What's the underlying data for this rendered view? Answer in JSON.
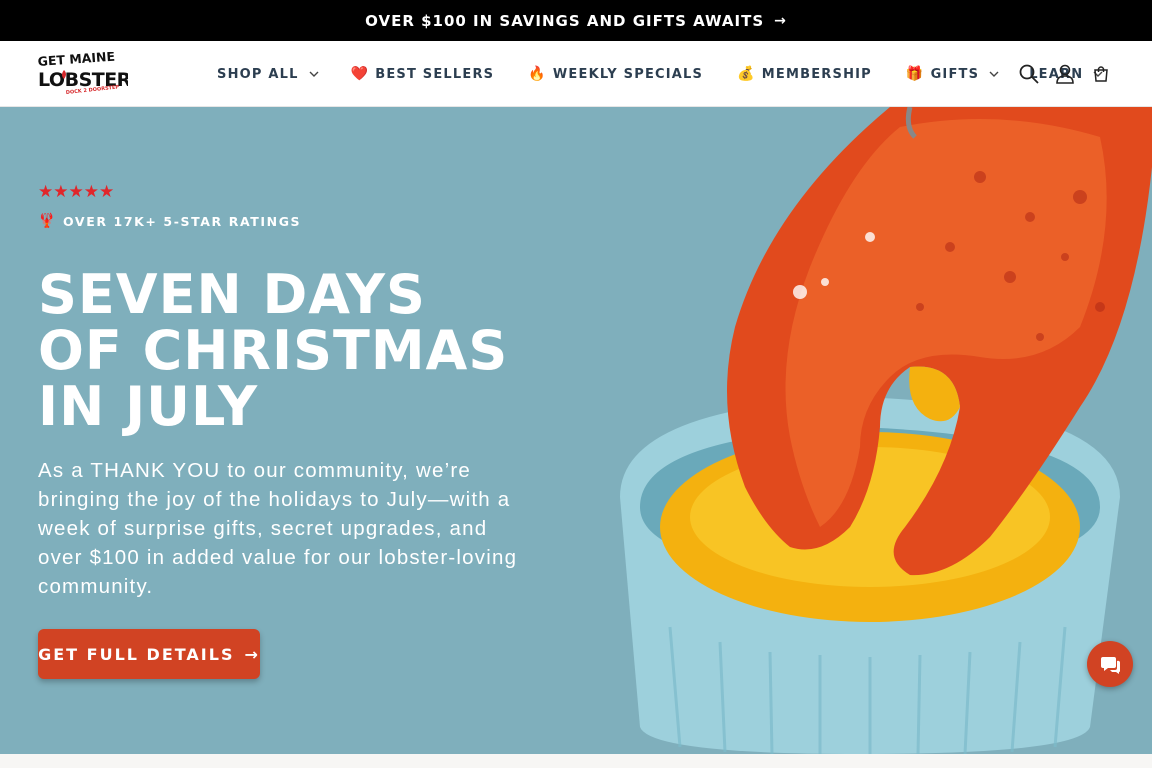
{
  "announcement": {
    "text": "OVER $100 IN SAVINGS AND GIFTS AWAITS",
    "arrow": "→"
  },
  "header": {
    "logo": {
      "line1": "GET MAINE",
      "line2": "LOBSTER",
      "tagline": "DOCK 2 DOORSTEP"
    },
    "nav": [
      {
        "label": "SHOP ALL",
        "emoji": "",
        "has_dropdown": true
      },
      {
        "label": "BEST SELLERS",
        "emoji": "❤️",
        "has_dropdown": false
      },
      {
        "label": "WEEKLY SPECIALS",
        "emoji": "🔥",
        "has_dropdown": false
      },
      {
        "label": "MEMBERSHIP",
        "emoji": "💰",
        "has_dropdown": false
      },
      {
        "label": "GIFTS",
        "emoji": "🎁",
        "has_dropdown": true
      },
      {
        "label": "LEARN",
        "emoji": "",
        "has_dropdown": true
      }
    ],
    "icons": [
      "search-icon",
      "account-icon",
      "cart-icon"
    ]
  },
  "hero": {
    "stars": "★★★★★",
    "ratings_emoji": "🦞",
    "ratings_text": "OVER 17K+ 5-STAR RATINGS",
    "title_lines": [
      "SEVEN DAYS",
      "OF CHRISTMAS",
      "IN JULY"
    ],
    "body": "As a THANK YOU to our community, we’re bringing the joy of the holidays to July—with a week of surprise gifts, secret upgrades, and over $100 in added value for our lobster-loving community.",
    "cta_label": "GET FULL DETAILS",
    "cta_arrow": "→"
  },
  "colors": {
    "announcement_bg": "#000000",
    "hero_bg": "#7fafbc",
    "accent": "#d14323",
    "star": "#e0262b"
  }
}
